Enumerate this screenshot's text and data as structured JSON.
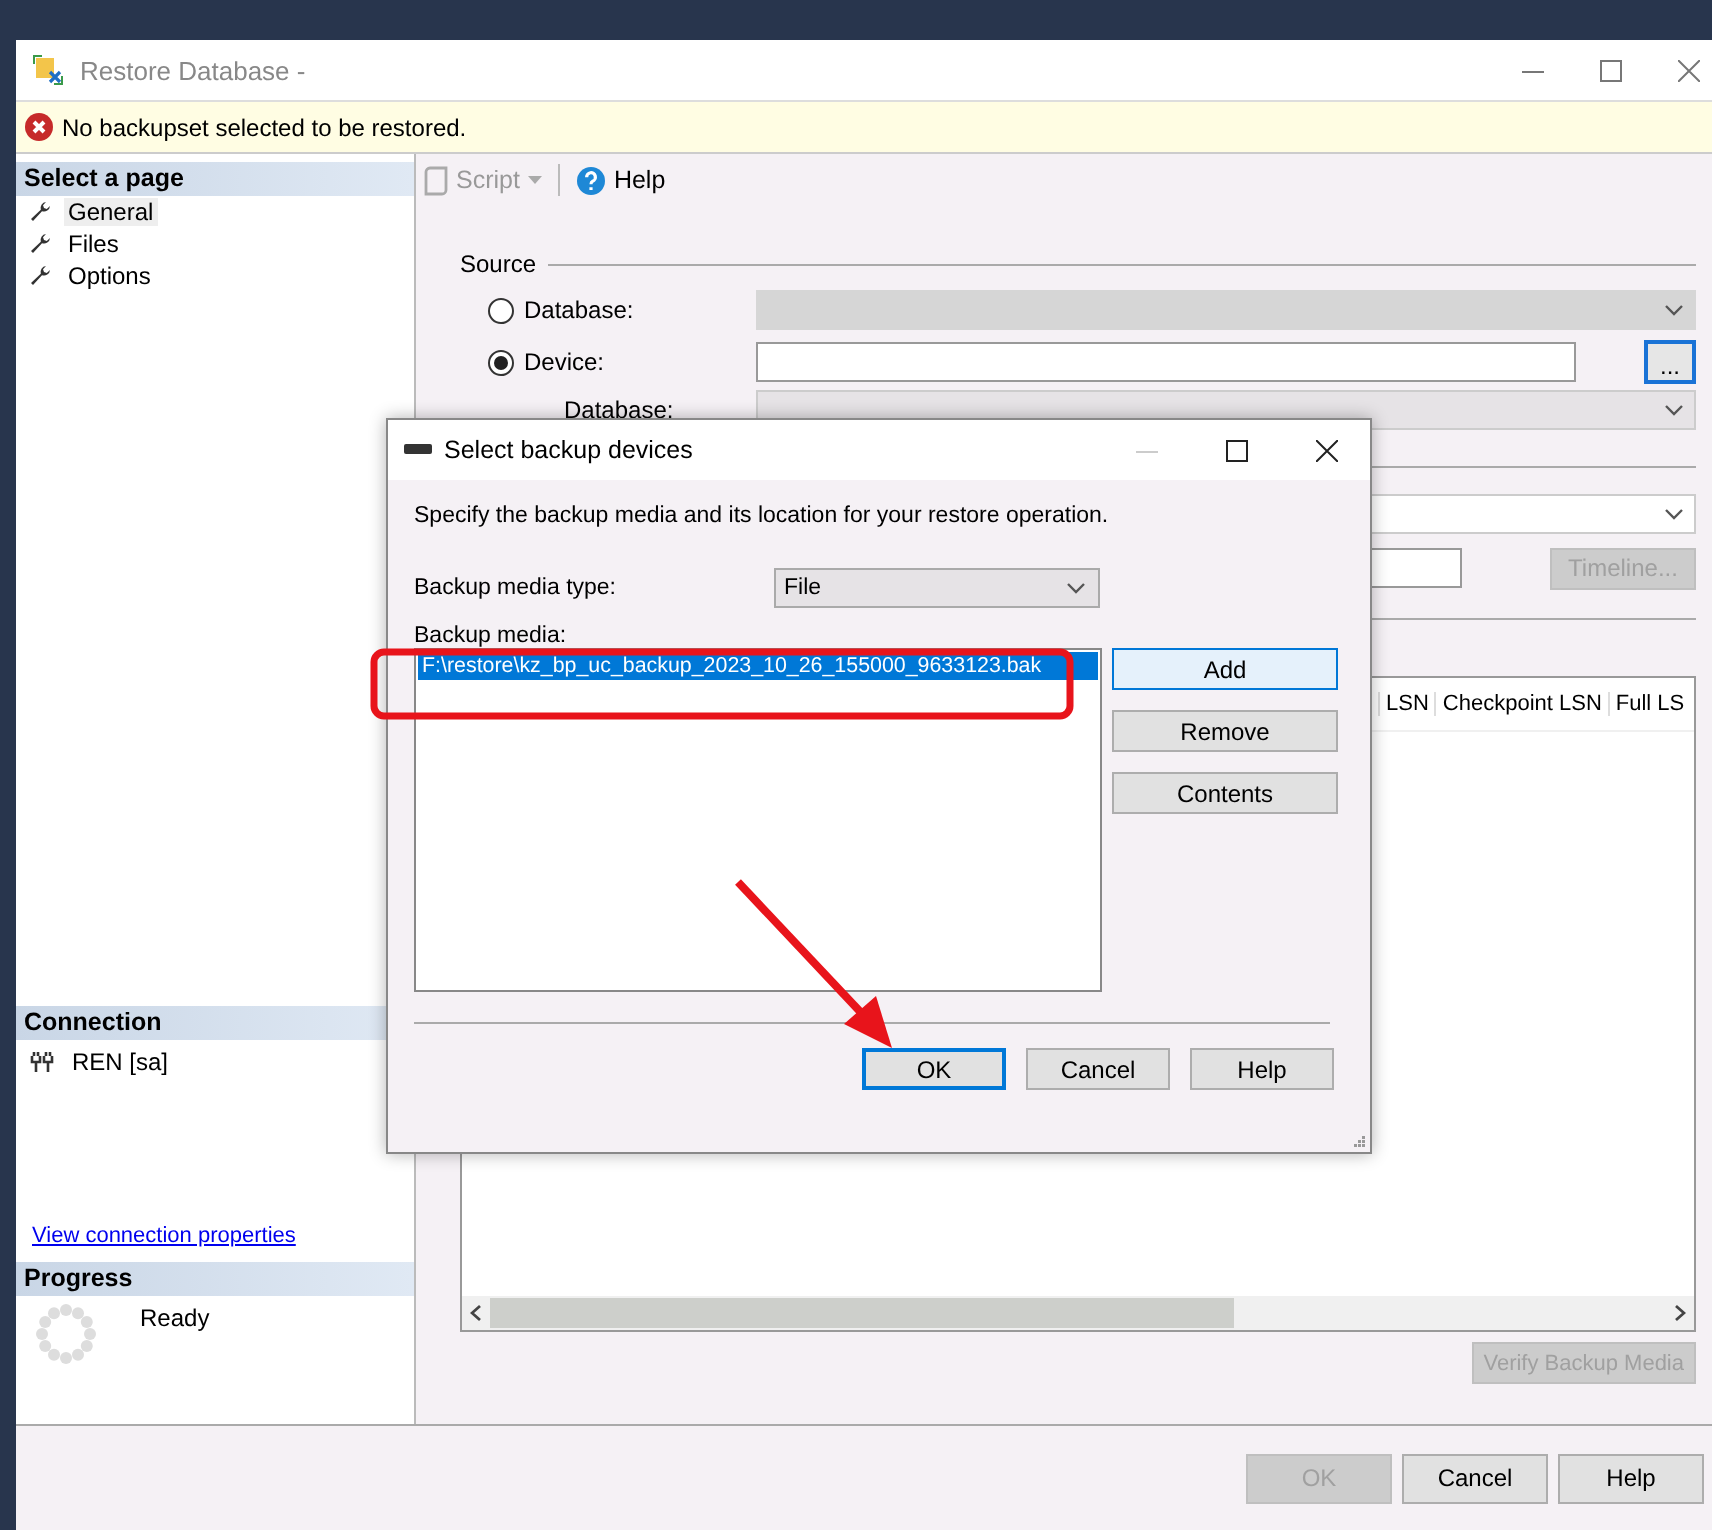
{
  "window": {
    "title": "Restore Database -"
  },
  "message": {
    "kind": "error",
    "text": "No backupset selected to be restored."
  },
  "sidebar": {
    "header": "Select a page",
    "pages": [
      {
        "label": "General",
        "selected": true
      },
      {
        "label": "Files",
        "selected": false
      },
      {
        "label": "Options",
        "selected": false
      }
    ],
    "connection": {
      "header": "Connection",
      "server": "REN [sa]",
      "link": "View connection properties"
    },
    "progress": {
      "header": "Progress",
      "status": "Ready"
    }
  },
  "toolbar": [
    {
      "kind": "script",
      "label": "Script"
    },
    {
      "kind": "help",
      "label": "Help"
    }
  ],
  "source": {
    "title": "Source",
    "options": [
      {
        "label": "Database:",
        "selected": false
      },
      {
        "label": "Device:",
        "selected": true
      }
    ],
    "device_button": "...",
    "database_label": "Database:"
  },
  "timeline_button": {
    "label": "Timeline...",
    "disabled": true
  },
  "backup_sets": {
    "columns": [
      "LSN",
      "Checkpoint LSN",
      "Full LS"
    ]
  },
  "verify_button": {
    "label": "Verify Backup Media",
    "disabled": true
  },
  "buttons": [
    {
      "label": "OK",
      "disabled": true
    },
    {
      "label": "Cancel",
      "disabled": false
    },
    {
      "label": "Help",
      "disabled": false
    }
  ],
  "dialog": {
    "title": "Select backup devices",
    "description": "Specify the backup media and its location for your restore operation.",
    "media_type_label": "Backup media type:",
    "media_type": "File",
    "media_label": "Backup media:",
    "media": [
      {
        "path": "F:\\restore\\kz_bp_uc_backup_2023_10_26_155000_9633123.bak",
        "selected": true
      }
    ],
    "side_buttons": [
      {
        "label": "Add",
        "default": true
      },
      {
        "label": "Remove",
        "default": false
      },
      {
        "label": "Contents",
        "default": false
      }
    ],
    "buttons": [
      {
        "label": "OK",
        "default": true
      },
      {
        "label": "Cancel",
        "default": false
      },
      {
        "label": "Help",
        "default": false
      }
    ]
  },
  "annotations": {
    "highlight_box": true,
    "arrow": true
  }
}
